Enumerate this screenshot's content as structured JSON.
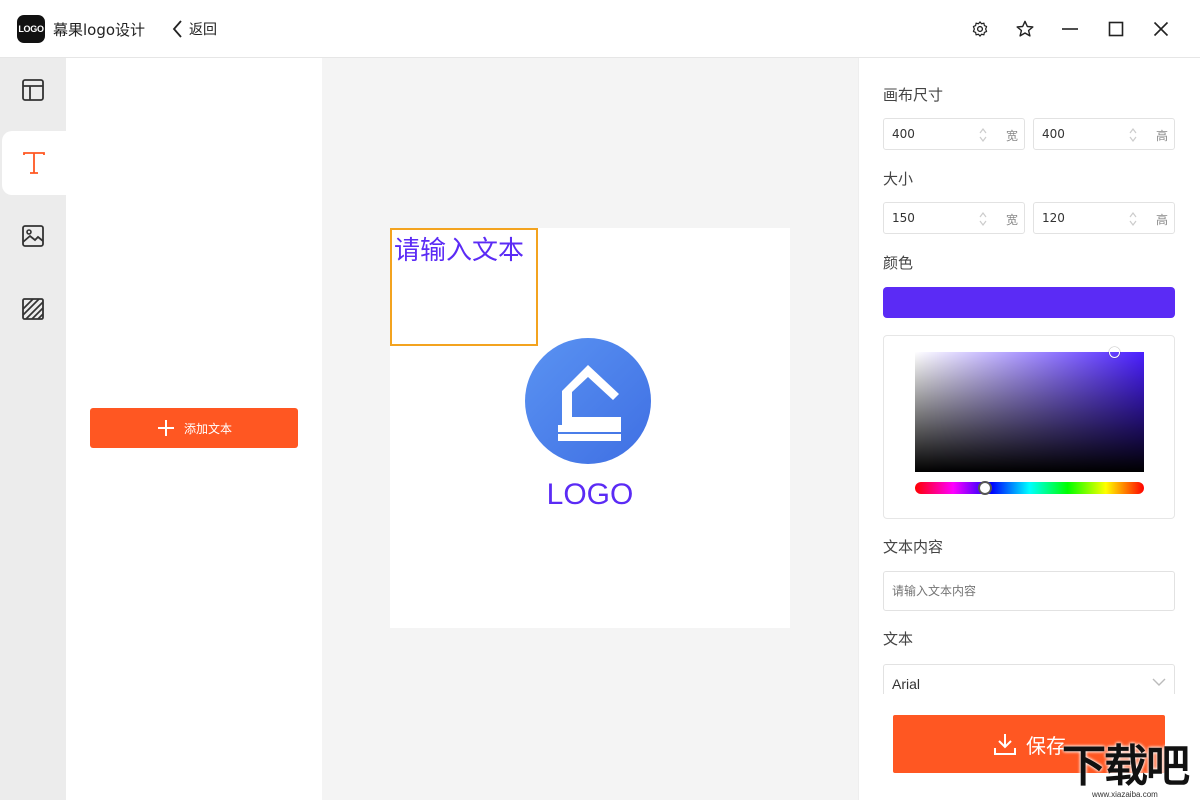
{
  "app": {
    "logo_text": "LOGO",
    "title": "幕果logo设计",
    "back_label": "返回"
  },
  "window_controls": [
    "gear-icon",
    "star-icon",
    "minimize-icon",
    "maximize-icon",
    "close-icon"
  ],
  "rail": {
    "items": [
      {
        "name": "template",
        "icon": "layout-icon",
        "active": false
      },
      {
        "name": "text",
        "icon": "text-icon",
        "active": true
      },
      {
        "name": "image",
        "icon": "image-icon",
        "active": false
      },
      {
        "name": "background",
        "icon": "hatch-icon",
        "active": false
      }
    ]
  },
  "panel": {
    "add_text_label": "添加文本"
  },
  "canvas": {
    "text_box_content": "请输入文本",
    "logo_label": "LOGO",
    "text_color": "#5b2bf5",
    "circle_color": "#4f86ec"
  },
  "props": {
    "canvas_size_label": "画布尺寸",
    "canvas_width": "400",
    "canvas_height": "400",
    "size_label": "大小",
    "size_width": "150",
    "size_height": "120",
    "width_unit": "宽",
    "height_unit": "高",
    "color_label": "颜色",
    "color_value": "#5b2bf5",
    "text_content_label": "文本内容",
    "text_content_placeholder": "请输入文本内容",
    "font_label": "文本",
    "font_value": "Arial",
    "save_label": "保存"
  },
  "accent_color": "#ff5722",
  "watermark": {
    "text": "下载吧",
    "url": "www.xiazaiba.com"
  }
}
